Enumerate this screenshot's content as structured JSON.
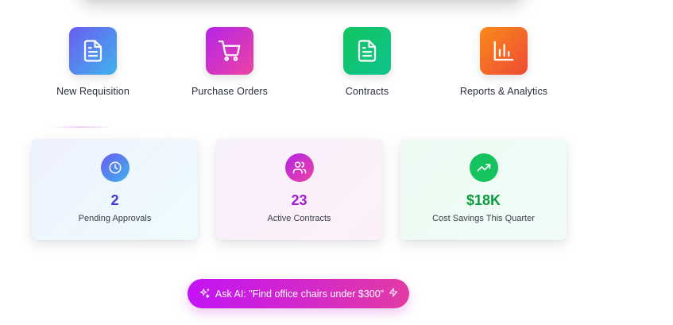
{
  "quick_actions": [
    {
      "label": "New Requisition",
      "icon": "document-icon",
      "color": "#4f8ff0"
    },
    {
      "label": "Purchase Orders",
      "icon": "shopping-cart-icon",
      "color": "#d033d6"
    },
    {
      "label": "Contracts",
      "icon": "contract-document-icon",
      "color": "#11c35d"
    },
    {
      "label": "Reports & Analytics",
      "icon": "bar-chart-icon",
      "color": "#f46a28"
    }
  ],
  "stats": [
    {
      "value": "2",
      "label": "Pending Approvals",
      "icon": "clock-icon",
      "color": "#3e39d6"
    },
    {
      "value": "23",
      "label": "Active Contracts",
      "icon": "users-icon",
      "color": "#a01ad8"
    },
    {
      "value": "$18K",
      "label": "Cost Savings This Quarter",
      "icon": "trending-up-icon",
      "color": "#0c9a3e"
    }
  ],
  "ai_prompt": {
    "label": "Ask AI: \"Find office chairs under $300\"",
    "icon_left": "sparkles-icon",
    "icon_right": "lightning-bolt-icon"
  }
}
